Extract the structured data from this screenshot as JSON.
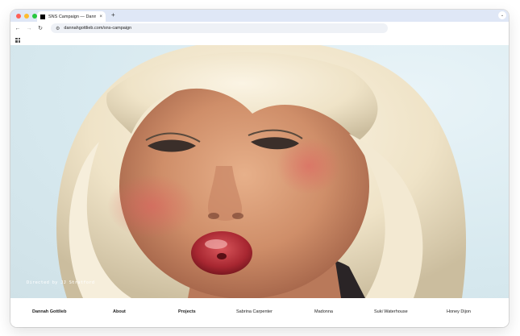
{
  "browser": {
    "tab_title": "SNS Campaign — Dannah Gottlieb",
    "new_tab_label": "+",
    "close_label": "×",
    "menu_label": "⌄",
    "url": "dannahgottlieb.com/sns-campaign",
    "back_icon": "←",
    "forward_icon": "→",
    "reload_icon": "↻",
    "site_info_icon": "⚙"
  },
  "hero": {
    "credit": "Directed by JJ Stratford"
  },
  "nav": {
    "items": [
      {
        "label": "Dannah Gottlieb",
        "bold": true
      },
      {
        "label": "About",
        "bold": true
      },
      {
        "label": "Projects",
        "bold": true
      },
      {
        "label": "Sabrina Carpenter",
        "bold": false
      },
      {
        "label": "Madonna",
        "bold": false
      },
      {
        "label": "Suki Waterhouse",
        "bold": false
      },
      {
        "label": "Honey Dijon",
        "bold": false
      }
    ]
  },
  "colors": {
    "tabstrip": "#dfe7f6",
    "accent": "#111111"
  }
}
